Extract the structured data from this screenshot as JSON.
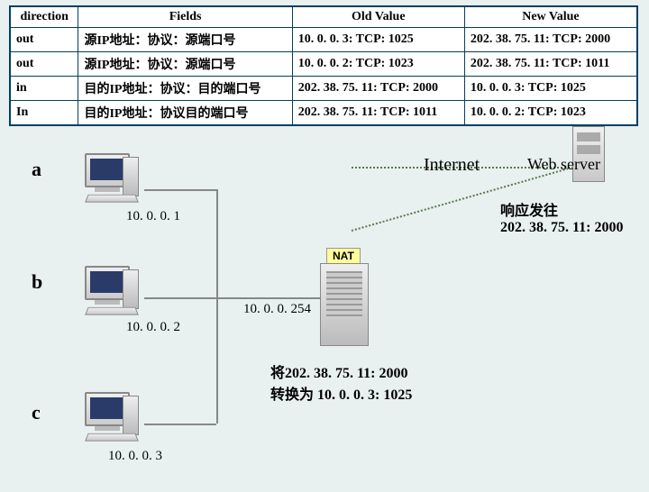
{
  "table": {
    "headers": [
      "direction",
      "Fields",
      "Old Value",
      "New Value"
    ],
    "rows": [
      {
        "direction": "out",
        "fields": "源IP地址：协议：源端口号",
        "old": "10. 0. 0. 3: TCP: 1025",
        "new": "202. 38. 75. 11: TCP: 2000"
      },
      {
        "direction": "out",
        "fields": "源IP地址：协议：源端口号",
        "old": "10. 0. 0. 2: TCP: 1023",
        "new": "202. 38. 75. 11: TCP: 1011"
      },
      {
        "direction": "in",
        "fields": "目的IP地址：协议：目的端口号",
        "old": "202. 38. 75. 11: TCP: 2000",
        "new": "10. 0. 0. 3: TCP: 1025"
      },
      {
        "direction": "In",
        "fields": "目的IP地址：协议目的端口号",
        "old": "202. 38. 75. 11: TCP: 1011",
        "new": "10. 0. 0. 2: TCP: 1023"
      }
    ]
  },
  "hosts": {
    "a": {
      "label": "a",
      "ip": "10. 0. 0. 1"
    },
    "b": {
      "label": "b",
      "ip": "10. 0. 0. 2"
    },
    "c": {
      "label": "c",
      "ip": "10. 0. 0. 3"
    }
  },
  "nat": {
    "label": "NAT",
    "ip": "10. 0. 0. 254"
  },
  "internet_label": "Internet",
  "webserver_label": "Web server",
  "response_text": "响应发往\n202. 38. 75. 11: 2000",
  "translate_text": "将202. 38. 75. 11: 2000\n转换为 10. 0. 0. 3: 1025"
}
